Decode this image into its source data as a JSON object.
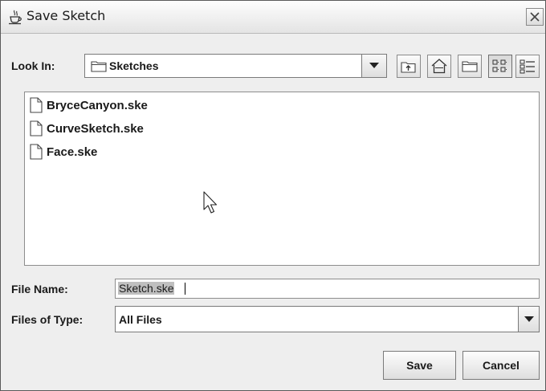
{
  "window": {
    "title": "Save Sketch"
  },
  "look_in": {
    "label": "Look In:",
    "selected": "Sketches"
  },
  "toolbar": {
    "buttons": [
      "up-one-level-icon",
      "home-icon",
      "new-folder-icon",
      "list-view-icon",
      "details-view-icon"
    ],
    "active": "list-view-icon"
  },
  "files": [
    {
      "name": "BryceCanyon.ske"
    },
    {
      "name": "CurveSketch.ske"
    },
    {
      "name": "Face.ske"
    }
  ],
  "file_name": {
    "label": "File Name:",
    "value": "Sketch.ske"
  },
  "file_type": {
    "label": "Files of Type:",
    "selected": "All Files"
  },
  "actions": {
    "save_label": "Save",
    "cancel_label": "Cancel"
  }
}
